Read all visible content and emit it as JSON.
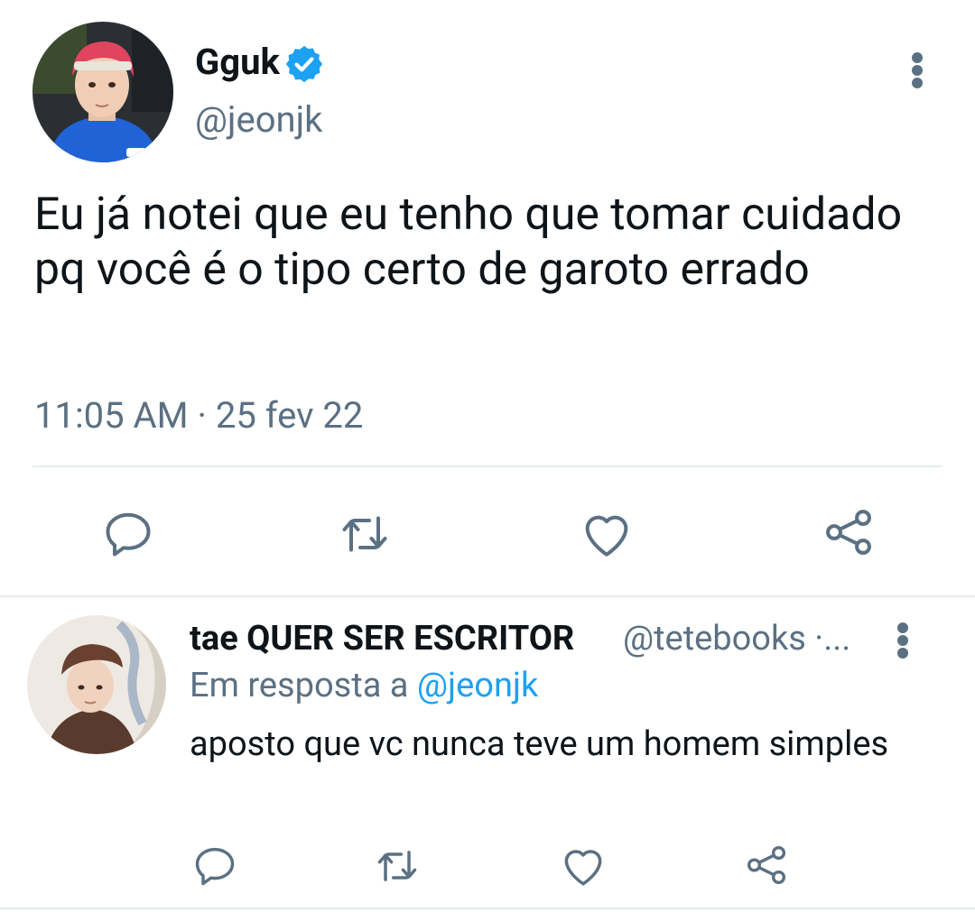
{
  "main_tweet": {
    "author_name": "Gguk",
    "author_handle": "@jeonjk",
    "text": "Eu já notei que eu tenho que tomar cuidado pq você é o tipo certo de garoto errado",
    "timestamp": "11:05 AM · 25 fev 22",
    "verified": true
  },
  "reply_tweet": {
    "author_name": "tae QUER SER ESCRITOR",
    "author_handle": "@tetebooks ·...",
    "reply_prefix": "Em resposta a",
    "reply_mention": "@jeonjk",
    "text": "aposto que vc nunca teve um homem simples"
  },
  "colors": {
    "text_primary": "#0f1419",
    "text_secondary": "#5b7083",
    "accent": "#1da1f2",
    "divider": "#e6ecf0"
  },
  "icons": [
    "verified-badge-icon",
    "more-vertical-icon",
    "reply-icon",
    "retweet-icon",
    "like-icon",
    "share-icon"
  ]
}
